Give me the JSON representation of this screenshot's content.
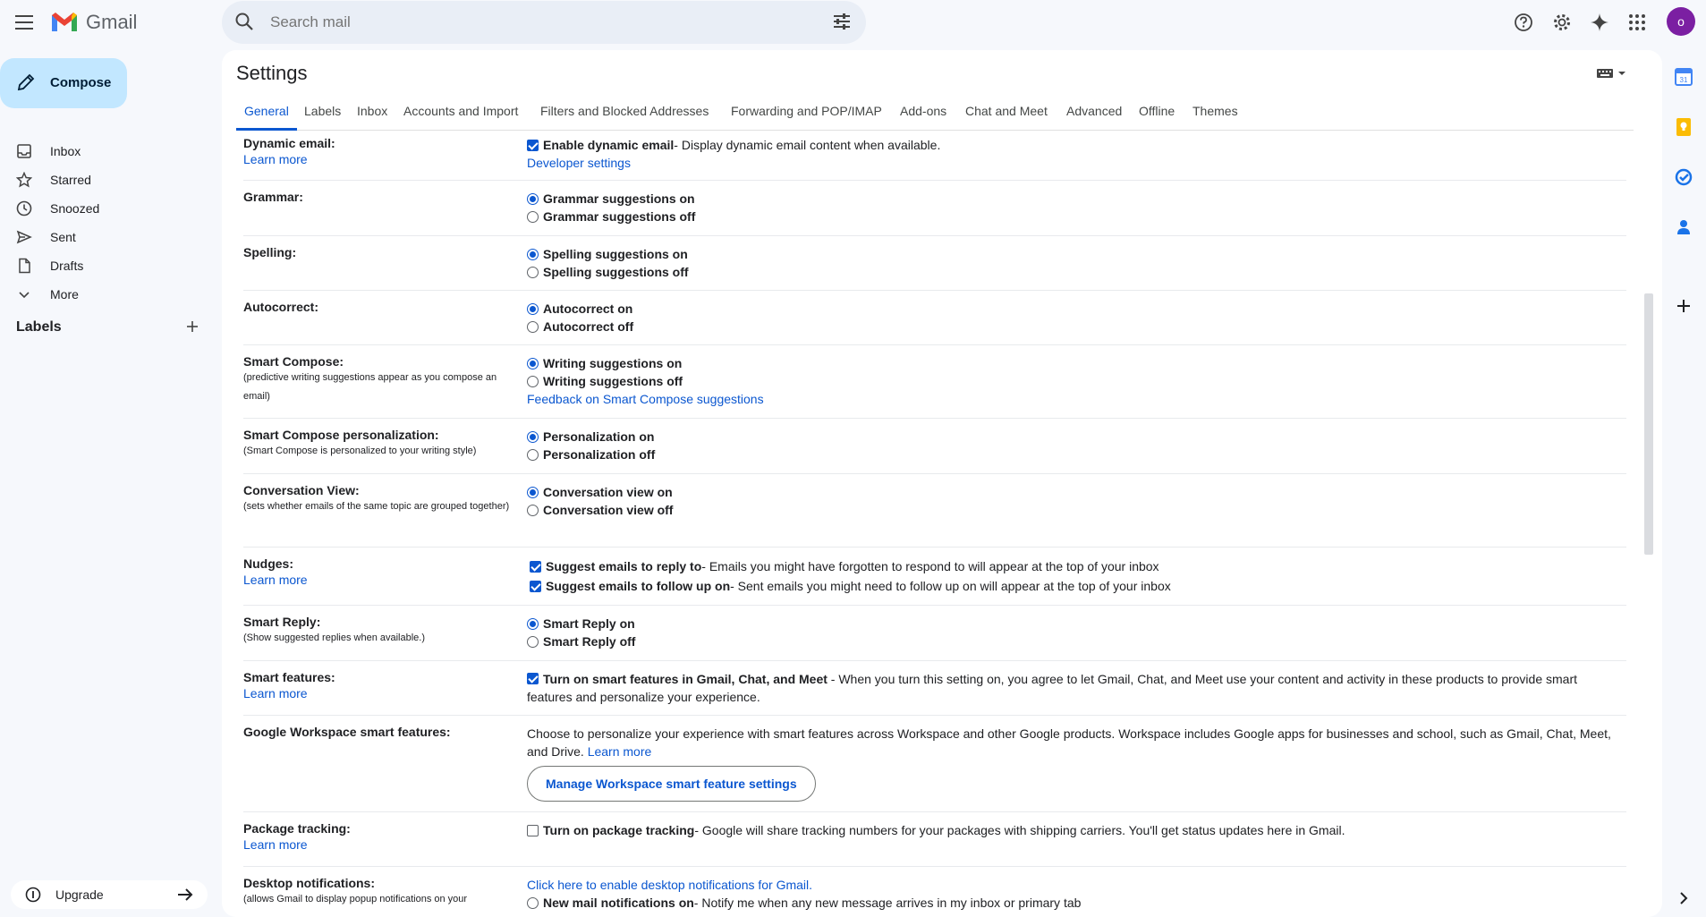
{
  "app": {
    "name": "Gmail"
  },
  "search": {
    "placeholder": "Search mail"
  },
  "user": {
    "avatar_letter": "o",
    "avatar_color": "#7b1fa2"
  },
  "sidebar": {
    "compose_label": "Compose",
    "items": [
      {
        "label": "Inbox",
        "icon": "inbox-icon"
      },
      {
        "label": "Starred",
        "icon": "star-icon"
      },
      {
        "label": "Snoozed",
        "icon": "clock-icon"
      },
      {
        "label": "Sent",
        "icon": "send-icon"
      },
      {
        "label": "Drafts",
        "icon": "file-icon"
      },
      {
        "label": "More",
        "icon": "chevron-down-icon"
      }
    ],
    "labels_heading": "Labels",
    "upgrade_label": "Upgrade"
  },
  "settings": {
    "title": "Settings",
    "tabs": [
      "General",
      "Labels",
      "Inbox",
      "Accounts and Import",
      "Filters and Blocked Addresses",
      "Forwarding and POP/IMAP",
      "Add-ons",
      "Chat and Meet",
      "Advanced",
      "Offline",
      "Themes"
    ],
    "active_tab": "General",
    "rows": {
      "dynamic": {
        "label": "Dynamic email:",
        "link": "Learn more",
        "opt_bold": "Enable dynamic email",
        "opt_desc": " - Display dynamic email content when available.",
        "checked": true,
        "body_link": "Developer settings"
      },
      "grammar": {
        "label": "Grammar:",
        "on": "Grammar suggestions on",
        "off": "Grammar suggestions off",
        "selected": "on"
      },
      "spelling": {
        "label": "Spelling:",
        "on": "Spelling suggestions on",
        "off": "Spelling suggestions off",
        "selected": "on"
      },
      "autocorrect": {
        "label": "Autocorrect:",
        "on": "Autocorrect on",
        "off": "Autocorrect off",
        "selected": "on"
      },
      "smart_compose": {
        "label": "Smart Compose:",
        "sub": "(predictive writing suggestions appear as you compose an email)",
        "on": "Writing suggestions on",
        "off": "Writing suggestions off",
        "selected": "on",
        "body_link": "Feedback on Smart Compose suggestions"
      },
      "personalization": {
        "label": "Smart Compose personalization:",
        "sub": "(Smart Compose is personalized to your writing style)",
        "on": "Personalization on",
        "off": "Personalization off",
        "selected": "on"
      },
      "conversation": {
        "label": "Conversation View:",
        "sub": "(sets whether emails of the same topic are grouped together)",
        "on": "Conversation view on",
        "off": "Conversation view off",
        "selected": "on"
      },
      "nudges": {
        "label": "Nudges:",
        "link": "Learn more",
        "opt1_bold": "Suggest emails to reply to",
        "opt1_desc": " - Emails you might have forgotten to respond to will appear at the top of your inbox",
        "opt2_bold": "Suggest emails to follow up on",
        "opt2_desc": " - Sent emails you might need to follow up on will appear at the top of your inbox",
        "opt1_checked": true,
        "opt2_checked": true
      },
      "smart_reply": {
        "label": "Smart Reply:",
        "sub": "(Show suggested replies when available.)",
        "on": "Smart Reply on",
        "off": "Smart Reply off",
        "selected": "on"
      },
      "smart_features": {
        "label": "Smart features:",
        "link": "Learn more",
        "opt_bold": "Turn on smart features in Gmail, Chat, and Meet",
        "opt_desc": " - When you turn this setting on, you agree to let Gmail, Chat, and Meet use your content and activity in these products to provide smart features and personalize your experience.",
        "checked": true
      },
      "workspace": {
        "label": "Google Workspace smart features:",
        "text": "Choose to personalize your experience with smart features across Workspace and other Google products. Workspace includes Google apps for businesses and school, such as Gmail, Chat, Meet, and Drive.",
        "link": "Learn more",
        "button": "Manage Workspace smart feature settings"
      },
      "package": {
        "label": "Package tracking:",
        "link": "Learn more",
        "opt_bold": "Turn on package tracking",
        "opt_desc": " - Google will share tracking numbers for your packages with shipping carriers. You'll get status updates here in Gmail.",
        "checked": false
      },
      "desktop": {
        "label": "Desktop notifications:",
        "sub": "(allows Gmail to display popup notifications on your",
        "body_link": "Click here to enable desktop notifications for Gmail.",
        "opt_bold": "New mail notifications on",
        "opt_desc": " - Notify me when any new message arrives in my inbox or primary tab"
      }
    }
  },
  "colors": {
    "accent": "#0b57d0",
    "compose_bg": "#c2e7ff",
    "page_bg": "#f6f8fc"
  }
}
